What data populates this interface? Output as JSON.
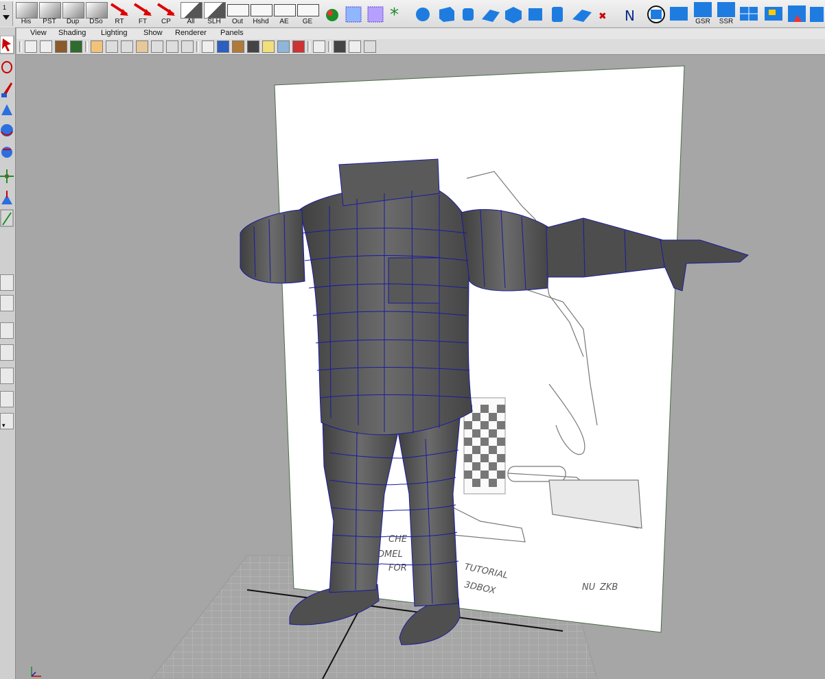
{
  "shelf": {
    "buttons": [
      {
        "label": "His",
        "icon": "history-icon"
      },
      {
        "label": "PST",
        "icon": "paste-icon"
      },
      {
        "label": "Dup",
        "icon": "duplicate-icon"
      },
      {
        "label": "DSo",
        "icon": "duplicate-special-icon"
      },
      {
        "label": "RT",
        "icon": "reset-transform-icon"
      },
      {
        "label": "FT",
        "icon": "freeze-transform-icon"
      },
      {
        "label": "CP",
        "icon": "center-pivot-icon"
      },
      {
        "label": "All",
        "icon": "select-all-icon"
      },
      {
        "label": "SLH",
        "icon": "select-hierarchy-icon"
      },
      {
        "label": "Out",
        "icon": "outliner-icon"
      },
      {
        "label": "Hshd",
        "icon": "hypershade-icon"
      },
      {
        "label": "AE",
        "icon": "attribute-editor-icon"
      },
      {
        "label": "GE",
        "icon": "graph-editor-icon"
      }
    ],
    "extra_buttons": [
      {
        "label": "GSR",
        "icon": "grid-subdiv-icon"
      },
      {
        "label": "SSR",
        "icon": "smooth-subdiv-icon"
      }
    ]
  },
  "menubar": {
    "items": [
      "View",
      "Shading",
      "Lighting",
      "Show",
      "Renderer",
      "Panels"
    ]
  },
  "viewport": {
    "sketch_text": [
      "CHE",
      "DMEL",
      "TUTORIAL",
      "FOR",
      "3DBOX",
      "NU",
      "ZKB"
    ]
  },
  "colors": {
    "wireframe": "#1a1aa0",
    "mesh": "#5b5b5b",
    "viewport_bg": "#a6a6a6",
    "grid": "#bdbdbd"
  }
}
